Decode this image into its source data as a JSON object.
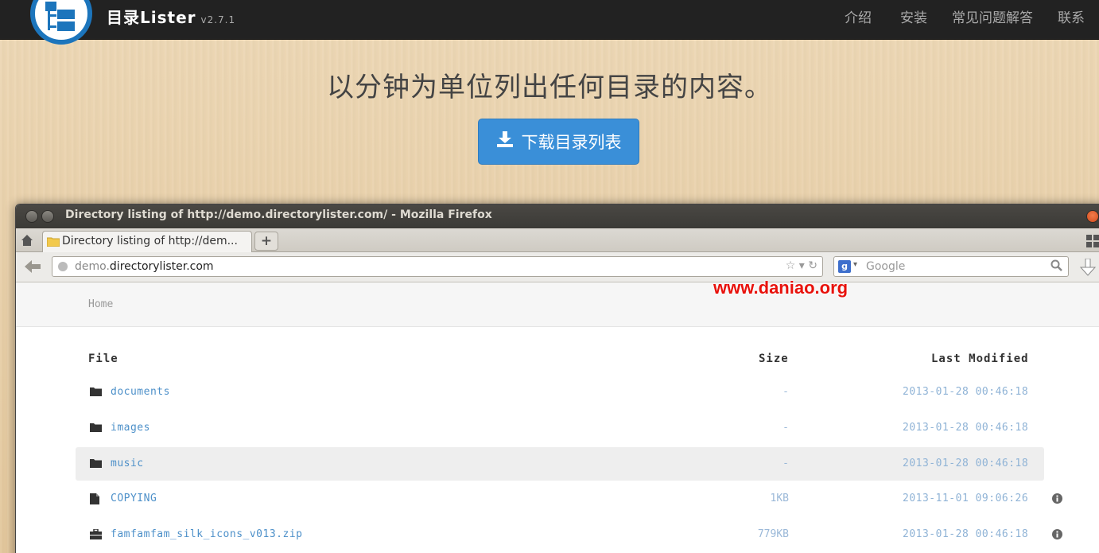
{
  "navbar": {
    "brand": "目录Lister",
    "version": "v2.7.1",
    "links": [
      "介绍",
      "安装",
      "常见问题解答",
      "联系"
    ]
  },
  "hero": {
    "title": "以分钟为单位列出任何目录的内容。",
    "download_label": "下载目录列表"
  },
  "browser": {
    "window_title": "Directory listing of http://demo.directorylister.com/ - Mozilla Firefox",
    "tab_title": "Directory listing of http://dem...",
    "url_prefix": "demo.",
    "url_domain": "directorylister.com",
    "search_placeholder": "Google"
  },
  "listing": {
    "breadcrumb": "Home",
    "headers": {
      "file": "File",
      "size": "Size",
      "modified": "Last Modified"
    },
    "rows": [
      {
        "name": "documents",
        "size": "-",
        "modified": "2013-01-28 00:46:18",
        "type": "folder"
      },
      {
        "name": "images",
        "size": "-",
        "modified": "2013-01-28 00:46:18",
        "type": "folder"
      },
      {
        "name": "music",
        "size": "-",
        "modified": "2013-01-28 00:46:18",
        "type": "folder"
      },
      {
        "name": "COPYING",
        "size": "1KB",
        "modified": "2013-11-01 09:06:26",
        "type": "file"
      },
      {
        "name": "famfamfam_silk_icons_v013.zip",
        "size": "779KB",
        "modified": "2013-01-28 00:46:18",
        "type": "archive"
      }
    ]
  },
  "watermark": "www.daniao.org",
  "colors": {
    "navbar": "#222222",
    "accent": "#3a8fd8",
    "link": "#4d90c9",
    "watermark": "#e8120c"
  }
}
